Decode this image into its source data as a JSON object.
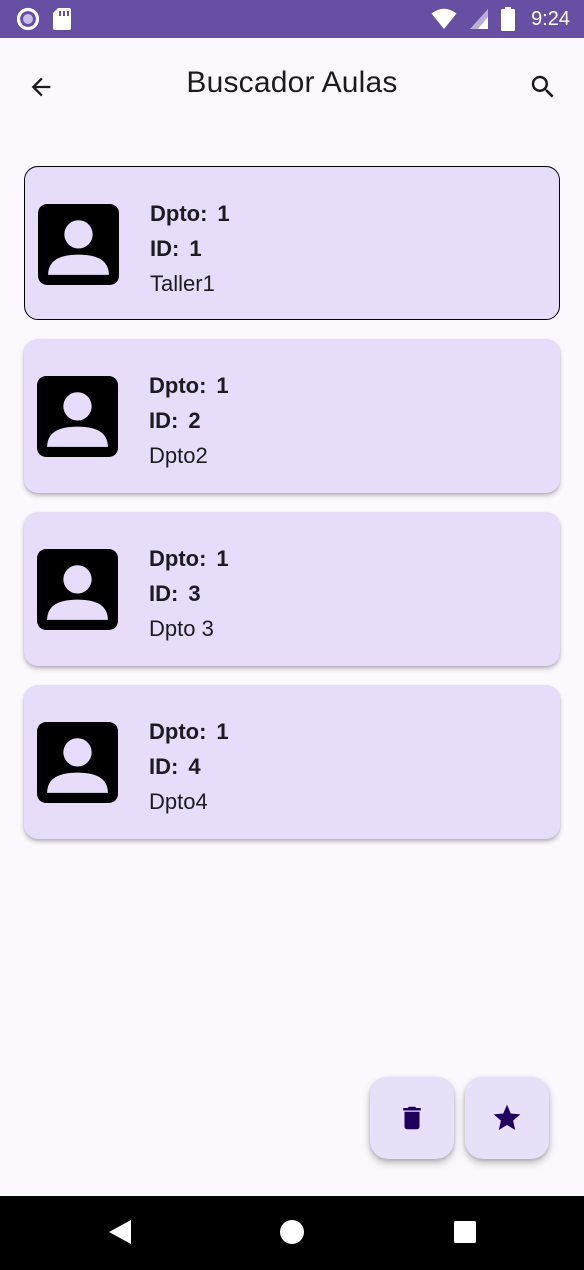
{
  "status_bar": {
    "time": "9:24",
    "background": "#6750a4"
  },
  "app_bar": {
    "title": "Buscador Aulas",
    "back_icon": "arrow-back-icon",
    "search_icon": "search-icon"
  },
  "items": [
    {
      "dpto_label": "Dpto:",
      "dpto_value": "1",
      "id_label": "ID:",
      "id_value": "1",
      "name": "Taller1",
      "selected": true
    },
    {
      "dpto_label": "Dpto:",
      "dpto_value": "1",
      "id_label": "ID:",
      "id_value": "2",
      "name": "Dpto2",
      "selected": false
    },
    {
      "dpto_label": "Dpto:",
      "dpto_value": "1",
      "id_label": "ID:",
      "id_value": "3",
      "name": "Dpto 3",
      "selected": false
    },
    {
      "dpto_label": "Dpto:",
      "dpto_value": "1",
      "id_label": "ID:",
      "id_value": "4",
      "name": "Dpto4",
      "selected": false
    }
  ],
  "fabs": {
    "delete_icon": "trash-icon",
    "favorite_icon": "star-icon",
    "icon_color": "#21005d",
    "background": "#e8dff8"
  },
  "colors": {
    "card_background": "#e7ddfb",
    "page_background": "#fdf8fd"
  }
}
